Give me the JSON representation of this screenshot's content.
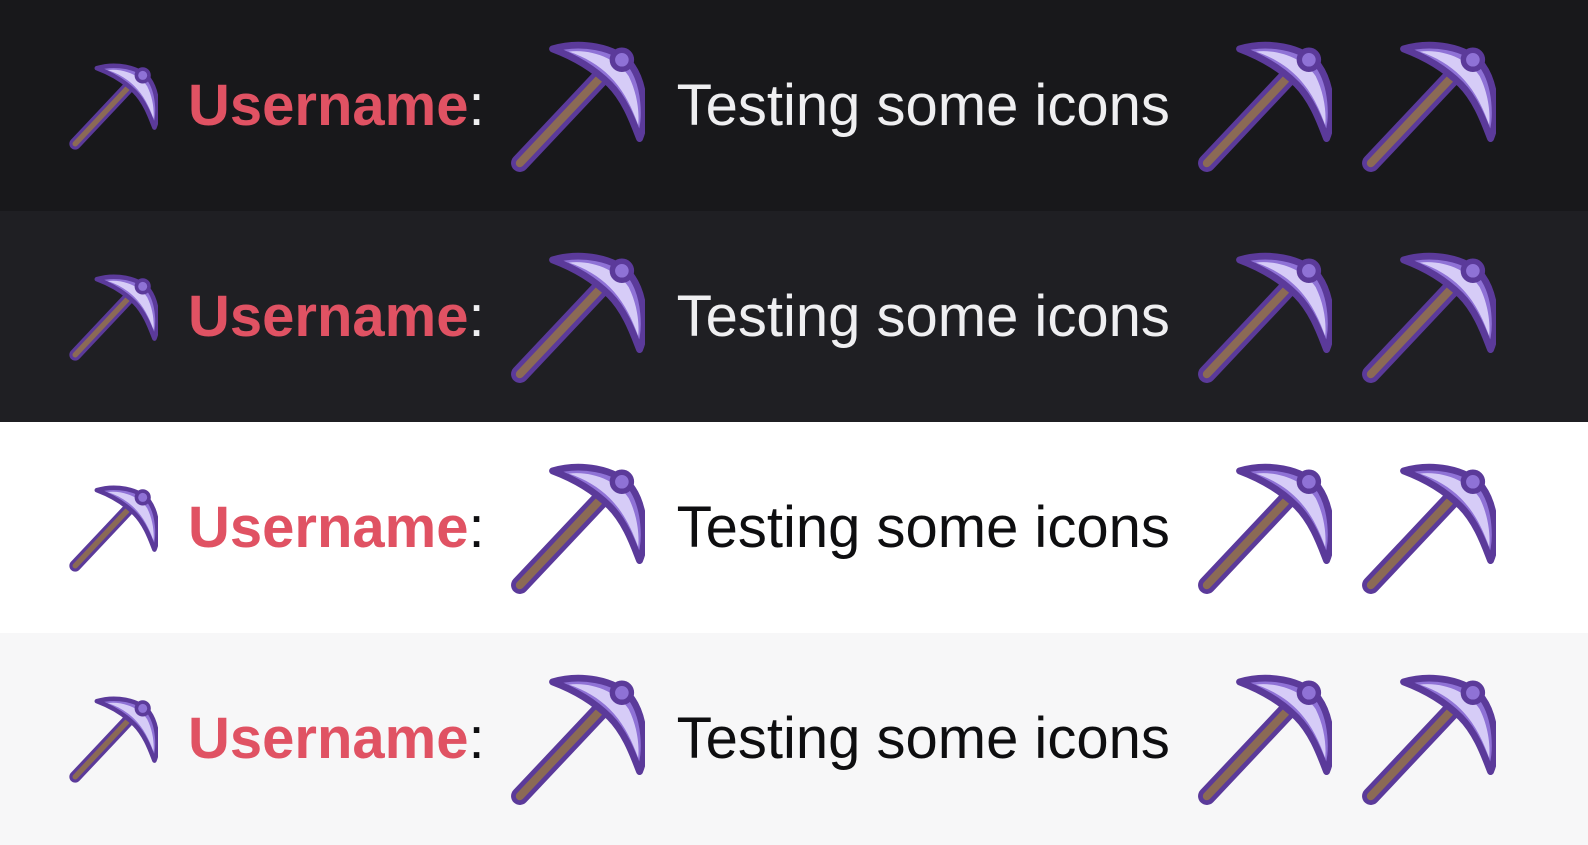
{
  "colors": {
    "username": "#e05263",
    "pickaxe_head_outline": "#5b3a9a",
    "pickaxe_head_fill": "#8f72d6",
    "pickaxe_highlight": "#d6ccf7",
    "handle": "#8b6a55"
  },
  "rows": [
    {
      "theme": "dark",
      "background": "#18181b",
      "text_color": "#efeff1",
      "username": "Username",
      "separator": ":",
      "message": "Testing some icons"
    },
    {
      "theme": "dark-alt",
      "background": "#1f1f23",
      "text_color": "#efeff1",
      "username": "Username",
      "separator": ":",
      "message": "Testing some icons"
    },
    {
      "theme": "light",
      "background": "#ffffff",
      "text_color": "#0e0e10",
      "username": "Username",
      "separator": ":",
      "message": "Testing some icons"
    },
    {
      "theme": "light-alt",
      "background": "#f7f7f8",
      "text_color": "#0e0e10",
      "username": "Username",
      "separator": ":",
      "message": "Testing some icons"
    }
  ],
  "icons": {
    "badge": "pickaxe-icon",
    "emote": "pickaxe-icon"
  }
}
